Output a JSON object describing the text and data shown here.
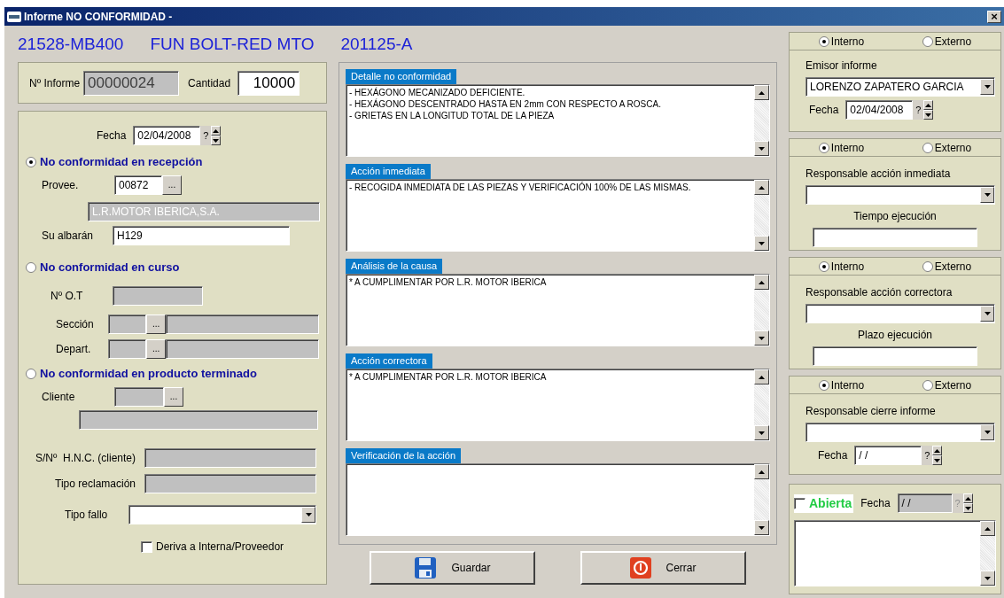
{
  "window": {
    "title": "Informe NO CONFORMIDAD -",
    "close": "×"
  },
  "header": [
    "21528-MB400",
    "FUN BOLT-RED MTO",
    "201125-A"
  ],
  "informe": {
    "label": "Nº Informe",
    "value": "00000024"
  },
  "cantidad": {
    "label": "Cantidad",
    "value": "10000"
  },
  "fecha": {
    "label": "Fecha",
    "value": "02/04/2008",
    "help": "?"
  },
  "reception": {
    "label": "No conformidad en recepción",
    "selected": true,
    "proveedor": {
      "label": "Provee.",
      "code": "00872",
      "lookup": "...",
      "name": "L.R.MOTOR IBERICA,S.A."
    },
    "albaran": {
      "label": "Su albarán",
      "value": "H129"
    }
  },
  "curso": {
    "label": "No conformidad en curso",
    "selected": false,
    "ot": {
      "label": "Nº O.T"
    },
    "seccion": {
      "label": "Sección",
      "lookup": "..."
    },
    "depart": {
      "label": "Depart.",
      "lookup": "..."
    }
  },
  "producto": {
    "label": "No conformidad en producto terminado",
    "selected": false,
    "cliente": {
      "label": "Cliente",
      "lookup": "..."
    }
  },
  "hnc": {
    "label": "S/Nº  H.N.C. (cliente)"
  },
  "tipo_reclamacion": {
    "label": "Tipo reclamación"
  },
  "tipo_fallo": {
    "label": "Tipo fallo"
  },
  "deriva": {
    "label": "Deriva a Interna/Proveedor",
    "checked": false
  },
  "sections": [
    {
      "title": "Detalle no conformidad",
      "lines": [
        "- HEXÁGONO MECANIZADO DEFICIENTE.",
        "- HEXÁGONO DESCENTRADO HASTA EN 2mm CON RESPECTO A ROSCA.",
        "- GRIETAS EN LA LONGITUD TOTAL DE LA PIEZA"
      ]
    },
    {
      "title": "Acción inmediata",
      "lines": [
        "- RECOGIDA INMEDIATA DE LAS PIEZAS Y VERIFICACIÓN 100% DE LAS MISMAS."
      ]
    },
    {
      "title": "Análisis de la causa",
      "lines": [
        "* A CUMPLIMENTAR POR L.R. MOTOR IBERICA"
      ]
    },
    {
      "title": "Acción correctora",
      "lines": [
        "* A CUMPLIMENTAR POR L.R. MOTOR IBERICA"
      ]
    },
    {
      "title": "Verificación de la acción"
    }
  ],
  "buttons": [
    {
      "label": "Guardar",
      "kind": "save"
    },
    {
      "label": "Cerrar",
      "kind": "close"
    }
  ],
  "panels": [
    {
      "kind": "emisor",
      "options": [
        {
          "label": "Interno",
          "selected": true
        },
        {
          "label": "Externo",
          "selected": false
        }
      ],
      "label": "Emisor informe",
      "value": "LORENZO ZAPATERO GARCIA",
      "date": {
        "label": "Fecha",
        "value": "02/04/2008",
        "help": "?"
      }
    },
    {
      "kind": "responsable",
      "options": [
        {
          "label": "Interno",
          "selected": true
        },
        {
          "label": "Externo",
          "selected": false
        }
      ],
      "label": "Responsable acción inmediata",
      "time_label": "Tiempo ejecución"
    },
    {
      "kind": "responsable",
      "options": [
        {
          "label": "Interno",
          "selected": true
        },
        {
          "label": "Externo",
          "selected": false
        }
      ],
      "label": "Responsable acción correctora",
      "time_label": "Plazo ejecución"
    },
    {
      "kind": "cierre",
      "options": [
        {
          "label": "Interno",
          "selected": true
        },
        {
          "label": "Externo",
          "selected": false
        }
      ],
      "label": "Responsable cierre informe",
      "date": {
        "label": "Fecha",
        "value": " / /",
        "help": "?"
      }
    }
  ],
  "abierta": {
    "label": "Abierta",
    "checked": false,
    "date": {
      "label": "Fecha",
      "value": " / /",
      "help": "?",
      "disabled": true
    }
  }
}
